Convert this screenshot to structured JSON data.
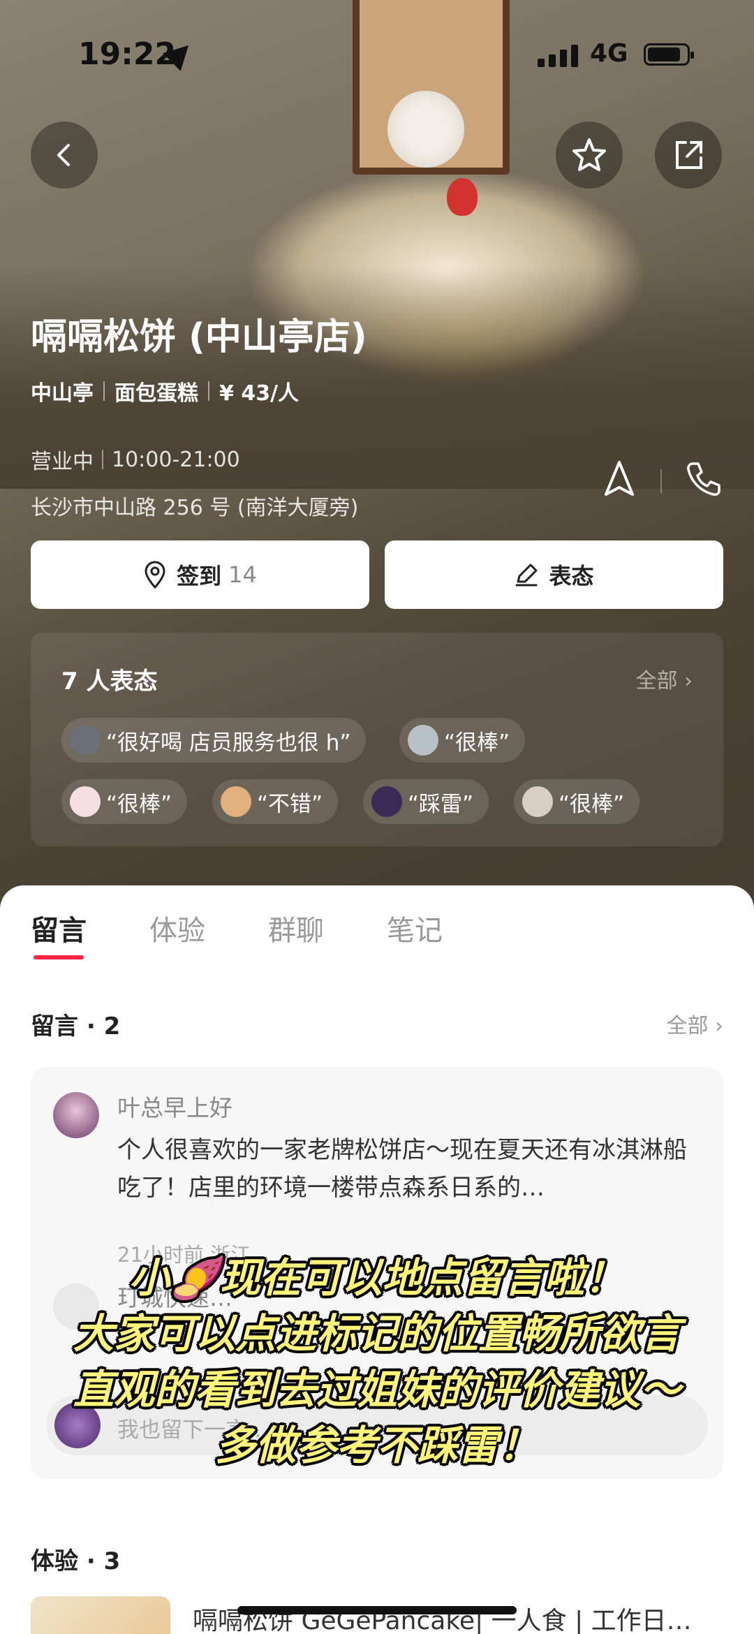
{
  "status_bar": {
    "time": "19:22",
    "network": "4G"
  },
  "shop": {
    "name": "嗝嗝松饼 (中山亭店)",
    "area": "中山亭",
    "category": "面包蛋糕",
    "price": "¥ 43/人",
    "open_status": "营业中",
    "hours": "10:00-21:00",
    "address": "长沙市中山路 256 号 (南洋大厦旁)"
  },
  "actions": {
    "checkin_label": "签到",
    "checkin_count": "14",
    "opinion_label": "表态"
  },
  "opinions": {
    "title": "7 人表态",
    "all_label": "全部",
    "chips": [
      {
        "text": "“很好喝 店员服务也很 h”"
      },
      {
        "text": "“很棒”"
      },
      {
        "text": "“很棒”"
      },
      {
        "text": "“不错”"
      },
      {
        "text": "“踩雷”"
      },
      {
        "text": "“很棒”"
      }
    ]
  },
  "tabs": [
    "留言",
    "体验",
    "群聊",
    "笔记"
  ],
  "messages_section": {
    "title": "留言 · 2",
    "all_label": "全部",
    "items": [
      {
        "name": "叶总早上好",
        "text": "个人很喜欢的一家老牌松饼店～现在夏天还有冰淇淋船吃了！店里的环境一楼带点森系日系的…",
        "meta": "21小时前 浙江"
      },
      {
        "name": "玎城快速…"
      }
    ],
    "reply_placeholder": "我也留下一言…"
  },
  "experience_section": {
    "title": "体验 · 3",
    "first_item": "嗝嗝松饼 GeGePancake| 一人食 | 工作日…"
  },
  "overlay_caption": [
    "小🍠现在可以地点留言啦！",
    "大家可以点进标记的位置畅所欲言",
    "直观的看到去过姐妹的评价建议～",
    "多做参考不踩雷！"
  ]
}
